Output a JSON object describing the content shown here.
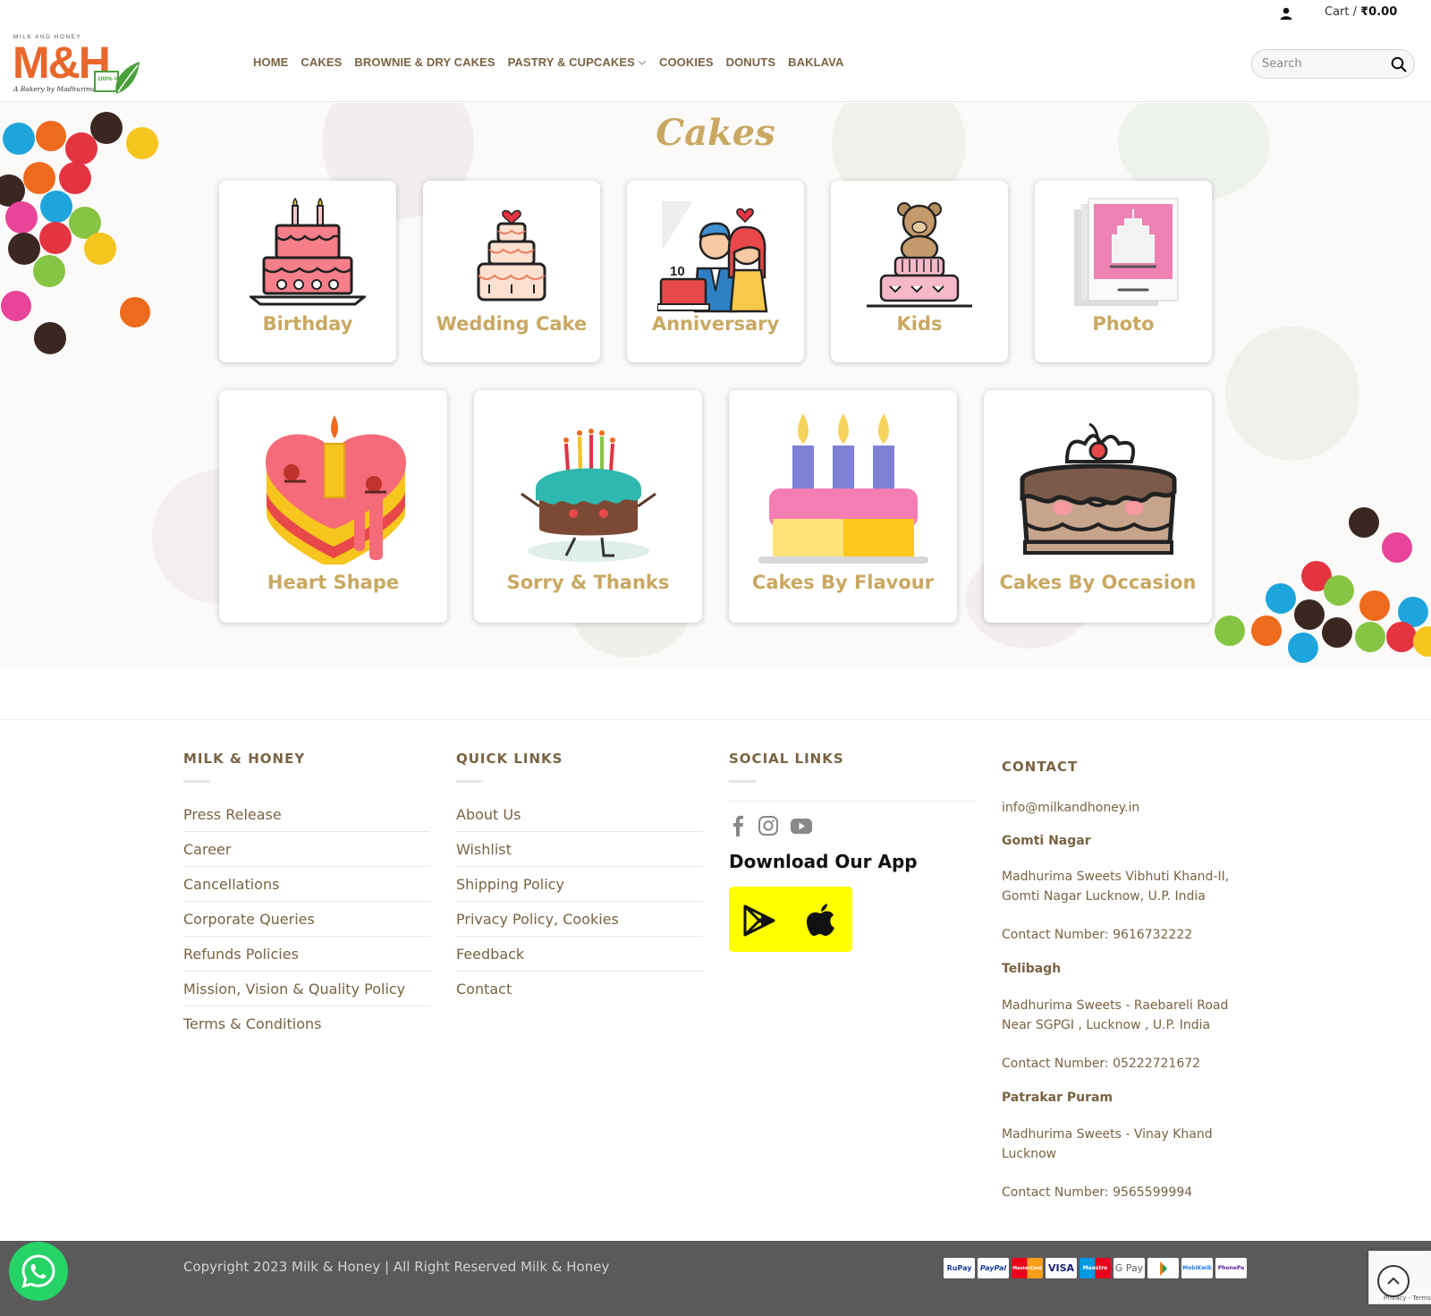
{
  "topbar": {
    "cart_label": "Cart /",
    "cart_amount": "₹0.00"
  },
  "header": {
    "logo_top": "MILK AND HONEY",
    "logo_main": "M&H",
    "logo_sub": "A Bakery by Madhurima",
    "logo_badge": "100% VEG",
    "nav": [
      {
        "label": "HOME"
      },
      {
        "label": "CAKES"
      },
      {
        "label": "BROWNIE & DRY CAKES"
      },
      {
        "label": "PASTRY & CUPCAKES"
      },
      {
        "label": "COOKIES"
      },
      {
        "label": "DONUTS"
      },
      {
        "label": "BAKLAVA"
      }
    ],
    "search_placeholder": "Search"
  },
  "hero": {
    "title": "Cakes",
    "categories_row1": [
      {
        "label": "Birthday",
        "icon": "birthday-cake-icon"
      },
      {
        "label": "Wedding Cake",
        "icon": "wedding-cake-icon"
      },
      {
        "label": "Anniversary",
        "icon": "anniversary-couple-icon"
      },
      {
        "label": "Kids",
        "icon": "teddy-cake-icon"
      },
      {
        "label": "Photo",
        "icon": "photo-cake-icon"
      }
    ],
    "categories_row2": [
      {
        "label": "Heart Shape",
        "icon": "heart-cake-icon"
      },
      {
        "label": "Sorry & Thanks",
        "icon": "sorry-cake-icon"
      },
      {
        "label": "Cakes By Flavour",
        "icon": "flavour-cake-icon"
      },
      {
        "label": "Cakes By Occasion",
        "icon": "occasion-cake-icon"
      }
    ],
    "anniversary_badge": "10"
  },
  "footer": {
    "col1": {
      "title": "MILK & HONEY",
      "links": [
        "Press Release",
        "Career",
        "Cancellations",
        "Corporate Queries",
        "Refunds Policies",
        "Mission, Vision & Quality Policy",
        "Terms & Conditions"
      ]
    },
    "col2": {
      "title": "QUICK LINKS",
      "links": [
        "About Us",
        "Wishlist",
        "Shipping Policy",
        "Privacy Policy, Cookies",
        "Feedback",
        "Contact"
      ]
    },
    "col3": {
      "title": "SOCIAL LINKS",
      "app_title": "Download Our App"
    },
    "col4": {
      "title": "CONTACT",
      "email": "info@milkandhoney.in",
      "branches": [
        {
          "name": "Gomti Nagar",
          "address1": "Madhurima Sweets Vibhuti Khand-II,",
          "address2": "Gomti Nagar Lucknow, U.P. India",
          "phone": "Contact Number: 9616732222"
        },
        {
          "name": "Telibagh",
          "address1": "Madhurima Sweets - Raebareli Road",
          "address2": "Near SGPGI , Lucknow , U.P. India",
          "phone": "Contact Number: 05222721672"
        },
        {
          "name": "Patrakar Puram",
          "address1": "Madhurima Sweets - Vinay Khand",
          "address2": "Lucknow",
          "phone": "Contact Number: 9565599994"
        }
      ]
    }
  },
  "bottom": {
    "copyright": "Copyright 2023 Milk & Honey | All Right Reserved Milk & Honey",
    "payments": [
      "RuPay",
      "PayPal",
      "MasterCard",
      "VISA",
      "Maestro",
      "G Pay",
      "",
      "MobiKwik",
      "PhonePe"
    ],
    "recaptcha": "Privacy - Terms"
  },
  "colors": {
    "brand_gold": "#c9a862",
    "brand_brown": "#7a6343",
    "logo_orange": "#e8672b",
    "app_yellow": "#ffff00",
    "footer_bar": "#5a5a5a",
    "whatsapp": "#25d366"
  }
}
